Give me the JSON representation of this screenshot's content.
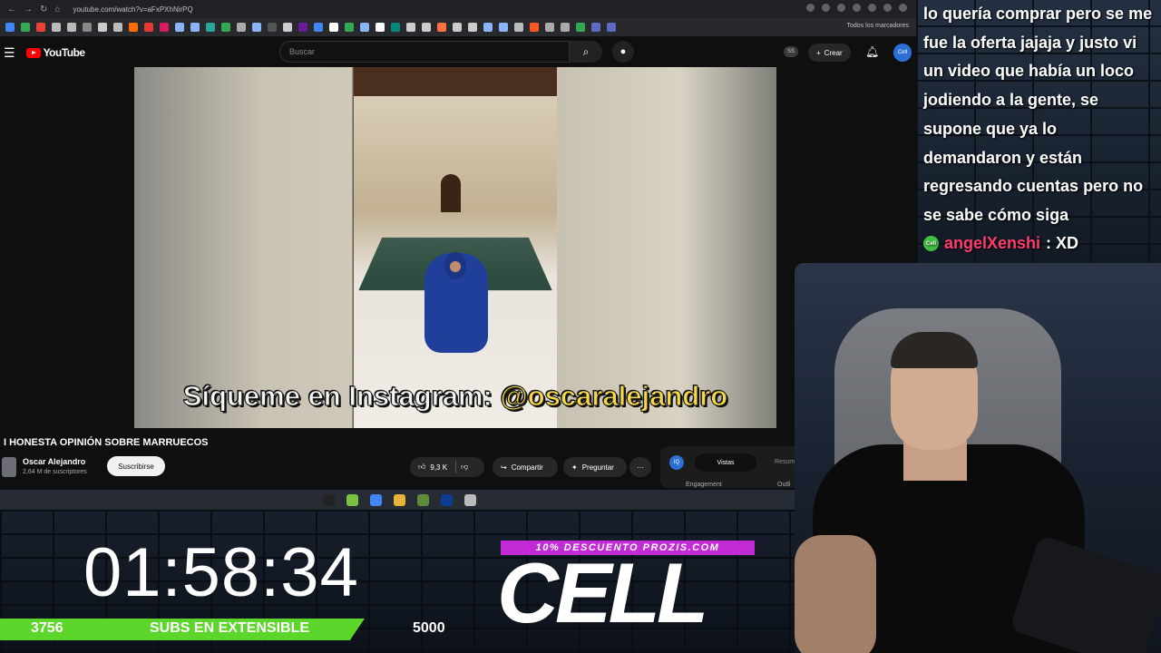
{
  "browser": {
    "url": "youtube.com/watch?v=aFxPXhNirPQ",
    "bookmarks_all_label": "Todos los marcadores",
    "bookmark_colors": [
      "#4285f4",
      "#34a853",
      "#ea4335",
      "#bbb",
      "#bbb",
      "#888",
      "#ccc",
      "#bbb",
      "#ff6d00",
      "#e53935",
      "#d81b60",
      "#8ab4f8",
      "#8ab4f8",
      "#26a69a",
      "#34a853",
      "#aaa",
      "#8ab4f8",
      "#555",
      "#ccc",
      "#6a1b9a",
      "#4285f4",
      "#fff",
      "#34a853",
      "#8ab4f8",
      "#fff",
      "#00897b",
      "#ccc",
      "#ccc",
      "#ff7043",
      "#ccc",
      "#ccc",
      "#8ab4f8",
      "#8ab4f8",
      "#bbb",
      "#ff5722",
      "#aaa",
      "#aaa",
      "#34a853",
      "#5c6bc0",
      "#5c6bc0"
    ]
  },
  "youtube": {
    "logo_text": "YouTube",
    "search_placeholder": "Buscar",
    "ss_badge": "SS",
    "create_label": "Crear",
    "avatar_text": "Cell"
  },
  "video": {
    "caption_prefix": "Síqueme en Instagram:",
    "caption_handle": "@oscaralejandro",
    "title": "I HONESTA OPINIÓN SOBRE MARRUECOS",
    "channel_name": "Oscar Alejandro",
    "channel_subs": "2,64 M de suscriptores",
    "subscribe_label": "Suscribirse",
    "likes": "9,3 K",
    "share_label": "Compartir",
    "ask_label": "Preguntar",
    "more_label": "···"
  },
  "sidepanel": {
    "badge": "IQ",
    "tab_active": "Vistas",
    "tab_other": "Resum",
    "label_left": "Engagement",
    "label_right": "Outli"
  },
  "taskbar_colors": [
    "#222",
    "#7cc242",
    "#4285f4",
    "#e8b33a",
    "#5d8c3a",
    "#0b3d91",
    "#bbb"
  ],
  "overlay": {
    "timer": "01:58:34",
    "subs_current": "3756",
    "subs_label": "SUBS EN EXTENSIBLE",
    "subs_goal": "5000",
    "subs_progress": 0.7512,
    "promo": "10% DESCUENTO PROZIS.COM",
    "sponsor": "CELL"
  },
  "chat": {
    "message_text": "lo quería comprar pero se me fue la oferta jajaja y justo vi un video que había un loco jodiendo a la gente, se supone que ya lo demandaron y están regresando cuentas pero no se sabe cómo siga",
    "badge_text": "Cell",
    "user": "angelXenshi",
    "user_msg": ": XD",
    "user_color": "#ff3c6e"
  }
}
